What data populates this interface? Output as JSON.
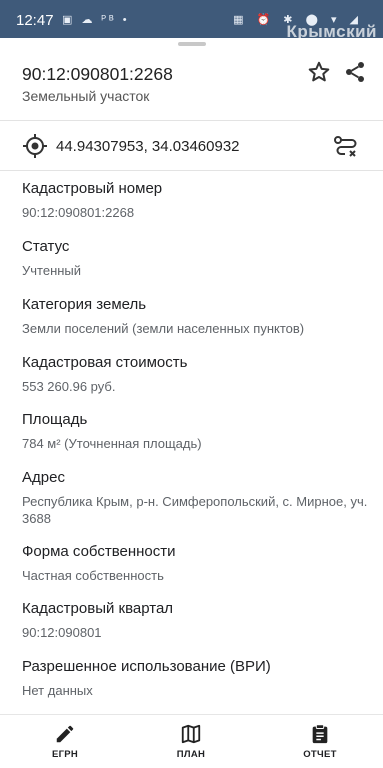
{
  "status_bar": {
    "time": "12:47",
    "left_icons": "▣ ☁ ᴾᴮ •",
    "right_icons": "▦ ⏰ ✱ ⬤ ▾ ◢",
    "watermark": "Крымский"
  },
  "header": {
    "title": "90:12:090801:2268",
    "subtitle": "Земельный участок",
    "star_icon": "star-outline-icon",
    "share_icon": "share-icon"
  },
  "coordinates": {
    "value": "44.94307953, 34.03460932",
    "locate_icon": "target-icon",
    "route_icon": "route-icon"
  },
  "fields": [
    {
      "label": "Кадастровый номер",
      "value": "90:12:090801:2268"
    },
    {
      "label": "Статус",
      "value": "Учтенный"
    },
    {
      "label": "Категория земель",
      "value": "Земли поселений (земли населенных пунктов)"
    },
    {
      "label": "Кадастровая стоимость",
      "value": "553 260.96 руб."
    },
    {
      "label": "Площадь",
      "value": "784 м² (Уточненная площадь)"
    },
    {
      "label": "Адрес",
      "value": "Республика Крым, р-н. Симферопольский, с. Мирное, уч. 3688"
    },
    {
      "label": "Форма собственности",
      "value": "Частная собственность"
    },
    {
      "label": "Кадастровый квартал",
      "value": "90:12:090801"
    },
    {
      "label": "Разрешенное использование (ВРИ)",
      "value": "Нет данных"
    }
  ],
  "bottom_nav": {
    "items": [
      {
        "label": "ЕГРН",
        "icon": "pencil-icon"
      },
      {
        "label": "ПЛАН",
        "icon": "map-icon"
      },
      {
        "label": "ОТЧЕТ",
        "icon": "clipboard-icon"
      }
    ]
  }
}
